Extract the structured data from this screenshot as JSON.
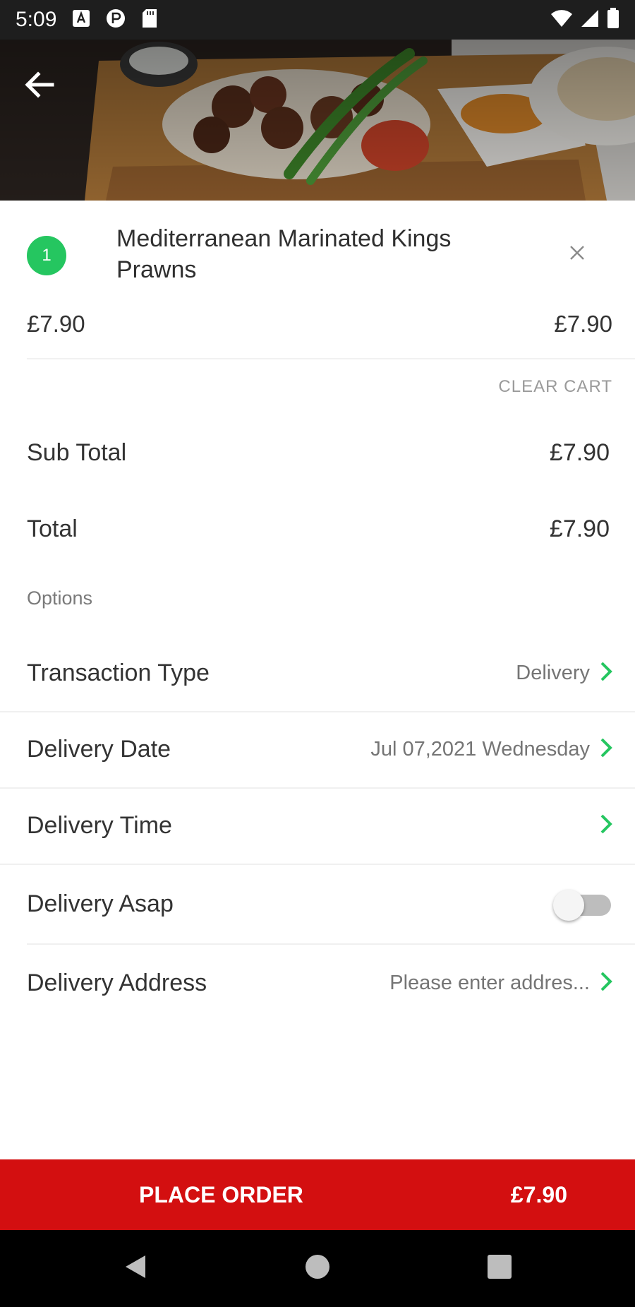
{
  "status_bar": {
    "time": "5:09"
  },
  "cart": {
    "items": [
      {
        "quantity": "1",
        "name": "Mediterranean Marinated Kings Prawns",
        "unit_price": "£7.90",
        "line_price": "£7.90"
      }
    ],
    "clear_cart_label": "CLEAR CART"
  },
  "summary": {
    "subtotal_label": "Sub Total",
    "subtotal_value": "£7.90",
    "total_label": "Total",
    "total_value": "£7.90"
  },
  "options": {
    "heading": "Options",
    "transaction_type": {
      "label": "Transaction Type",
      "value": "Delivery"
    },
    "delivery_date": {
      "label": "Delivery Date",
      "value": "Jul 07,2021 Wednesday"
    },
    "delivery_time": {
      "label": "Delivery Time",
      "value": ""
    },
    "delivery_asap": {
      "label": "Delivery Asap",
      "enabled": false
    },
    "delivery_address": {
      "label": "Delivery Address",
      "value": "Please enter addres..."
    }
  },
  "place_order": {
    "label": "PLACE ORDER",
    "amount": "£7.90"
  },
  "colors": {
    "accent_green": "#25c660",
    "place_order_red": "#d30f10",
    "status_bar": "#1e1e1e"
  },
  "icons": {
    "back": "arrow-left-icon",
    "remove": "close-icon",
    "chevron": "chevron-right-icon",
    "nav_back": "triangle-back-icon",
    "nav_home": "circle-home-icon",
    "nav_recents": "square-recents-icon"
  }
}
